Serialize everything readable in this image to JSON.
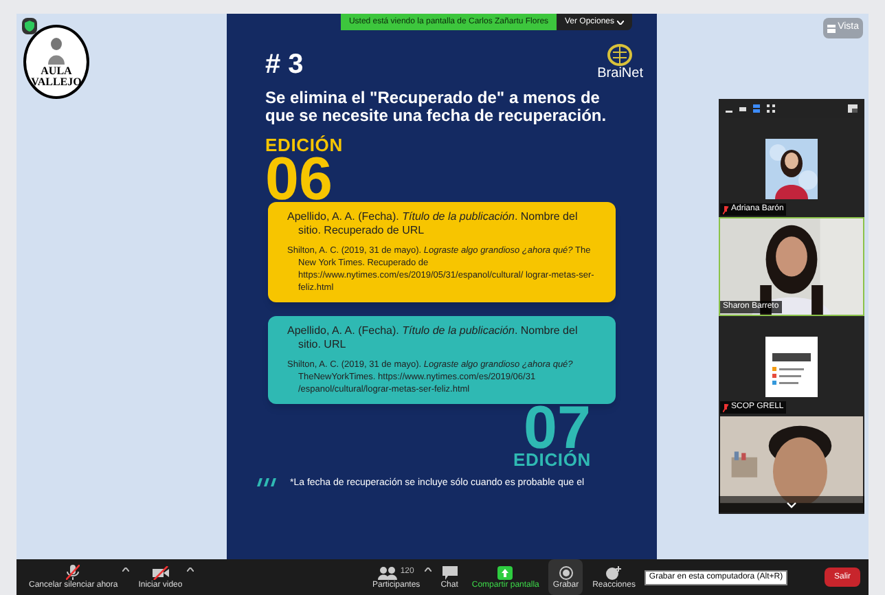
{
  "banner": {
    "text": "Usted está viendo la pantalla de Carlos Zañartu Flores",
    "options_button": "Ver Opciones"
  },
  "view_button": "Vista",
  "logo": {
    "line1": "AULA",
    "line2": "VALLEJO"
  },
  "slide": {
    "number": "# 3",
    "brand": "BraiNet",
    "heading": "Se elimina el \"Recuperado de\" a menos de que se necesite una fecha de recuperación.",
    "sections": [
      {
        "kind": "top",
        "edition_label": "EDICIÓN",
        "edition_number": "06",
        "color": "#f7c500",
        "references": [
          "Apellido, A. A. (Fecha). *Título de la publicación*. Nombre del sitio. Recuperado de URL",
          "Shilton, A. C. (2019, 31 de mayo). *Lograste algo grandioso ¿ahora qué?* The New York Times. Recuperado de https://www.nytimes.com/es/2019/05/31/espanol/cultural/ lograr-metas-ser-feliz.html"
        ]
      },
      {
        "kind": "bottom",
        "edition_label": "EDICIÓN",
        "edition_number": "07",
        "color": "#2fb9b3",
        "references": [
          "Apellido, A. A. (Fecha). *Título de la publicación*. Nombre del sitio. URL",
          "Shilton, A. C. (2019, 31 de mayo). *Lograste algo grandioso ¿ahora qué?* TheNewYorkTimes. https://www.nytimes.com/es/2019/06/31 /espanol/cultural/lograr-metas-ser-feliz.html"
        ]
      }
    ],
    "footnote": "*La fecha de recuperación se incluye sólo cuando es probable que el"
  },
  "participants": [
    {
      "kind": "avatar",
      "name": "Adriana Barón",
      "muted": true,
      "speaking": false
    },
    {
      "kind": "video",
      "name": "Sharon Barreto",
      "muted": false,
      "speaking": true
    },
    {
      "kind": "logo",
      "name": "SCOP GRELL",
      "muted": true,
      "speaking": false
    },
    {
      "kind": "video_partial"
    }
  ],
  "toolbar": {
    "items": [
      {
        "kind": "mic",
        "label": "Cancelar silenciar ahora",
        "off": true,
        "menu": true
      },
      {
        "kind": "video",
        "label": "Iniciar video",
        "off": true,
        "menu": true
      },
      {
        "kind": "participants",
        "label": "Participantes",
        "count": "120",
        "menu": true
      },
      {
        "kind": "chat",
        "label": "Chat",
        "menu": false
      },
      {
        "kind": "share",
        "label": "Compartir pantalla",
        "menu": false
      },
      {
        "kind": "record",
        "label": "Grabar",
        "menu": false,
        "hovered": true
      },
      {
        "kind": "reactions",
        "label": "Reacciones",
        "menu": false
      }
    ],
    "tooltip": "Grabar en esta computadora (Alt+R)",
    "leave_button": "Salir"
  }
}
